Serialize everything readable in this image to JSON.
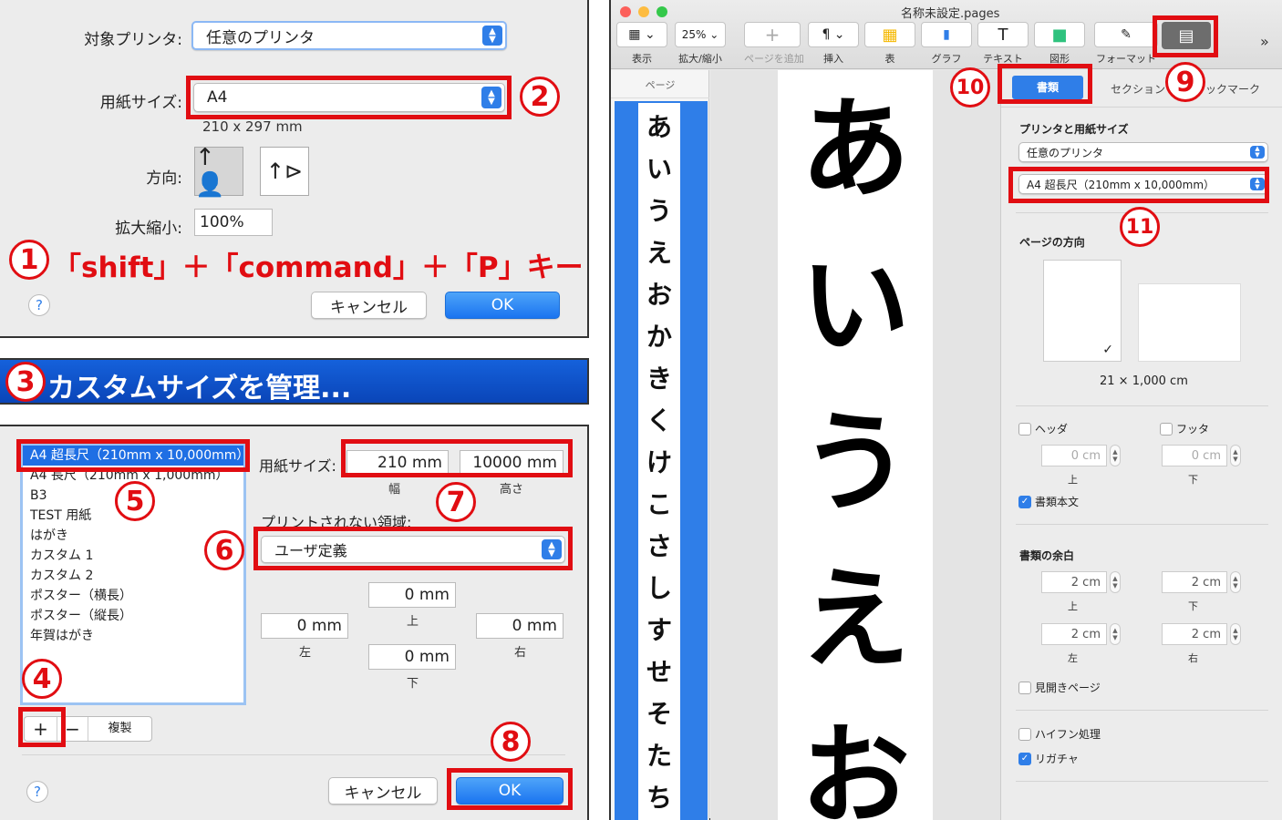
{
  "print_dialog": {
    "printer_label": "対象プリンタ:",
    "printer_value": "任意のプリンタ",
    "paper_label": "用紙サイズ:",
    "paper_value": "A4",
    "paper_dims": "210 x 297 mm",
    "orientation_label": "方向:",
    "scale_label": "拡大縮小:",
    "scale_value": "100%",
    "shortcut_text": "「shift」＋「command」＋「P」キー",
    "help": "?",
    "cancel": "キャンセル",
    "ok": "OK"
  },
  "custom_bar": {
    "text": "カスタムサイズを管理..."
  },
  "custom_dialog": {
    "list": [
      "A4 超長尺（210mm x 10,000mm）",
      "A4 長尺（210mm x 1,000mm）",
      "B3",
      "TEST 用紙",
      "はがき",
      "カスタム 1",
      "カスタム 2",
      "ポスター（横長）",
      "ポスター（縦長）",
      "年賀はがき"
    ],
    "paper_label": "用紙サイズ:",
    "width_value": "210 mm",
    "width_label": "幅",
    "height_value": "10000 mm",
    "height_label": "高さ",
    "nonprint_label": "プリントされない領域:",
    "nonprint_value": "ユーザ定義",
    "margin_top": "0 mm",
    "margin_top_label": "上",
    "margin_left": "0 mm",
    "margin_left_label": "左",
    "margin_right": "0 mm",
    "margin_right_label": "右",
    "margin_bottom": "0 mm",
    "margin_bottom_label": "下",
    "add": "+",
    "remove": "−",
    "duplicate": "複製",
    "help": "?",
    "cancel": "キャンセル",
    "ok": "OK"
  },
  "numbers": {
    "n1": "1",
    "n2": "2",
    "n3": "3",
    "n4": "4",
    "n5": "5",
    "n6": "6",
    "n7": "7",
    "n8": "8",
    "n9": "9",
    "n10": "10",
    "n11": "11"
  },
  "pages": {
    "title": "名称未設定.pages",
    "toolbar": [
      {
        "label": "表示",
        "icon": "▦ ⌄"
      },
      {
        "label": "拡大/縮小",
        "icon": "25% ⌄"
      },
      {
        "label": "ページを追加",
        "icon": "+"
      },
      {
        "label": "挿入",
        "icon": "¶ ⌄"
      },
      {
        "label": "表",
        "icon": "▦"
      },
      {
        "label": "グラフ",
        "icon": "▮"
      },
      {
        "label": "テキスト",
        "icon": "T"
      },
      {
        "label": "図形",
        "icon": "■"
      },
      {
        "label": "フォーマット",
        "icon": "✎"
      }
    ],
    "more": "»",
    "sidebar_title": "ページ",
    "thumb_chars": [
      "あ",
      "い",
      "う",
      "え",
      "お",
      "か",
      "き",
      "く",
      "け",
      "こ",
      "さ",
      "し",
      "す",
      "せ",
      "そ",
      "た",
      "ち"
    ],
    "page_chars": [
      "あ",
      "い",
      "う",
      "え",
      "お"
    ],
    "tabs": {
      "document": "書類",
      "section": "セクション",
      "bookmark": "ブックマーク"
    },
    "inspector": {
      "printer_section": "プリンタと用紙サイズ",
      "printer_value": "任意のプリンタ",
      "paper_value": "A4 超長尺（210mm x 10,000mm）",
      "orientation_section": "ページの方向",
      "size_text": "21 × 1,000 cm",
      "header": "ヘッダ",
      "footer": "フッタ",
      "header_value": "0 cm",
      "footer_value": "0 cm",
      "top": "上",
      "bottom": "下",
      "body": "書類本文",
      "margins_section": "書類の余白",
      "m_top": "2 cm",
      "m_bottom": "2 cm",
      "m_left": "2 cm",
      "m_right": "2 cm",
      "left": "左",
      "right": "右",
      "facing": "見開きページ",
      "hyphen": "ハイフン処理",
      "ligature": "リガチャ"
    }
  },
  "colors": {
    "highlight": "#e10d12",
    "accent": "#2f7ee8",
    "bar": "#0a4fc9"
  }
}
